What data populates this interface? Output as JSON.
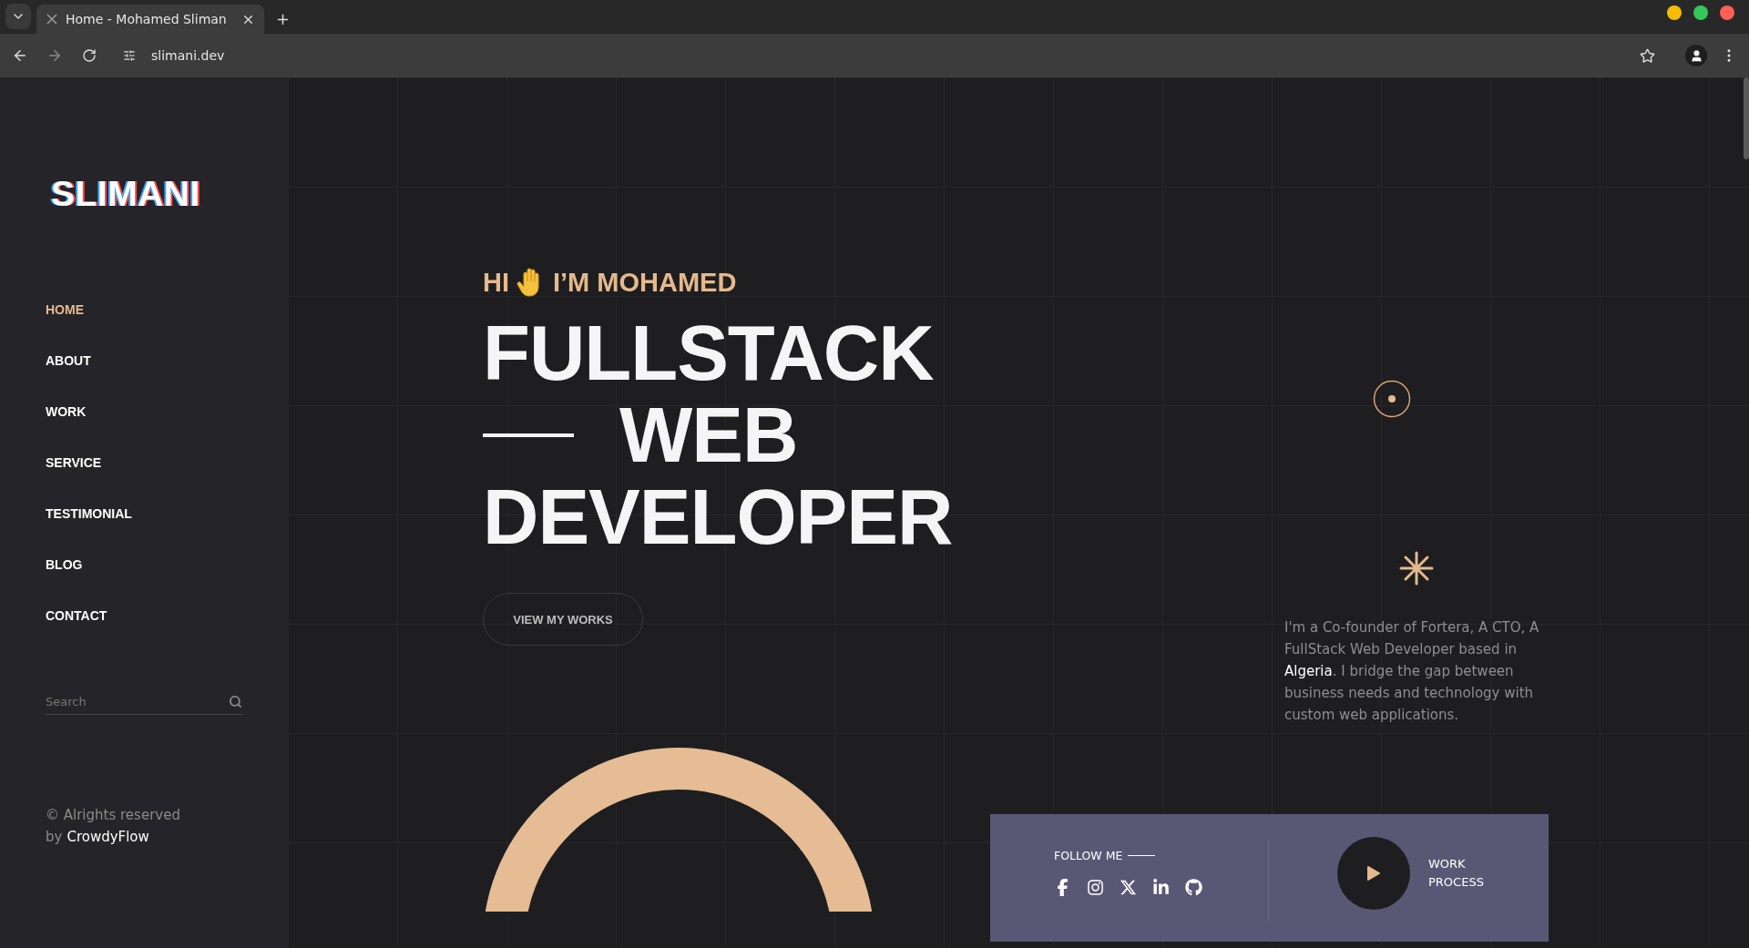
{
  "browser": {
    "tab": {
      "title": "Home - Mohamed Sliman"
    },
    "url": "slimani.dev"
  },
  "sidebar": {
    "logo": "SLIMANI",
    "nav": [
      {
        "label": "HOME",
        "selected": true
      },
      {
        "label": "ABOUT",
        "selected": false
      },
      {
        "label": "WORK",
        "selected": false
      },
      {
        "label": "SERVICE",
        "selected": false
      },
      {
        "label": "TESTIMONIAL",
        "selected": false
      },
      {
        "label": "BLOG",
        "selected": false
      },
      {
        "label": "CONTACT",
        "selected": false
      }
    ],
    "search": {
      "placeholder": "Search"
    },
    "footer": {
      "rights": "© Alrights reserved",
      "by": "by",
      "link": "CrowdyFlow"
    }
  },
  "hero": {
    "greeting_start": "HI",
    "greeting_end": "I’M MOHAMED",
    "title_lines": [
      "FULLSTACK",
      "WEB",
      "DEVELOPER"
    ],
    "button": "VIEW MY WORKS"
  },
  "about": {
    "text": "I'm a Co-founder of Fortera, A CTO, A FullStack Web Developer based in **Algeria**. I bridge the gap between business needs and technology with custom web applications."
  },
  "panel": {
    "follow_label": "FOLLOW ME",
    "work_process": "WORK PROCESS"
  }
}
